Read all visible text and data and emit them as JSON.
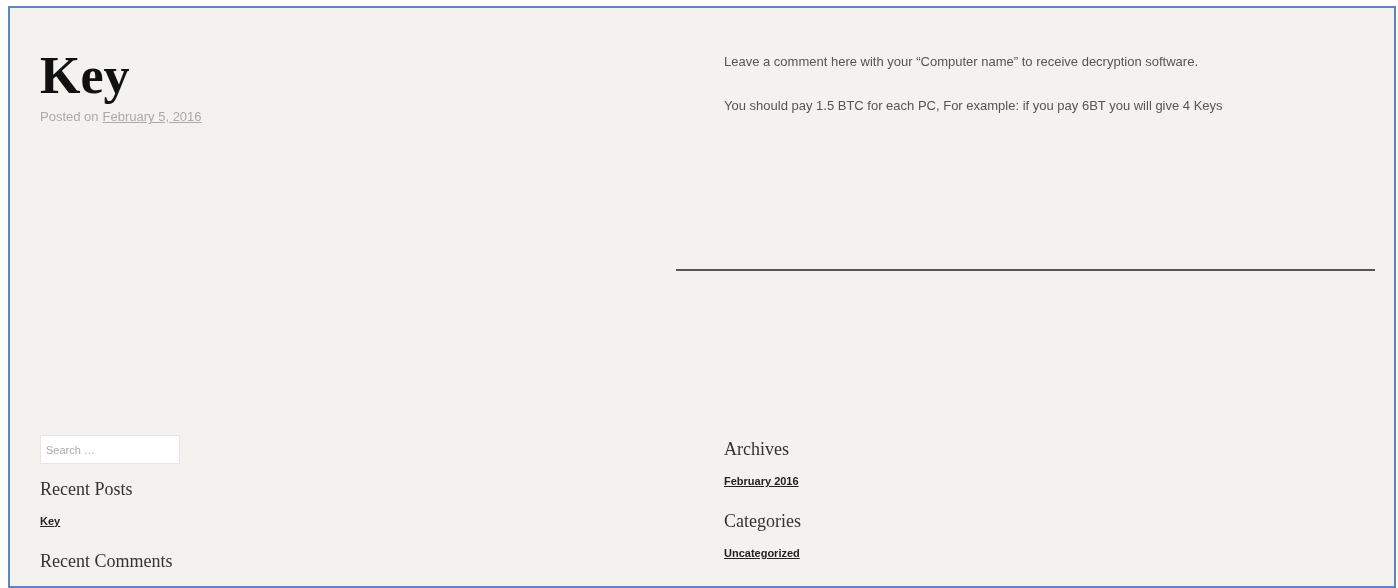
{
  "post": {
    "title": "Key",
    "meta_prefix": "Posted on",
    "date": "February 5, 2016",
    "paragraphs": [
      "Leave a comment here with your “Computer name” to receive decryption software.",
      "You should pay 1.5 BTC for each PC, For example: if you pay 6BT you will give 4 Keys"
    ]
  },
  "sidebar_left": [
    {
      "kind": "search",
      "placeholder": "Search …"
    },
    {
      "kind": "links",
      "title": "Recent Posts",
      "links": [
        "Key"
      ]
    },
    {
      "kind": "links",
      "title": "Recent Comments"
    }
  ],
  "sidebar_right": [
    {
      "kind": "links",
      "title": "Archives",
      "links": [
        "February 2016"
      ]
    },
    {
      "kind": "links",
      "title": "Categories",
      "links": [
        "Uncategorized"
      ]
    }
  ]
}
